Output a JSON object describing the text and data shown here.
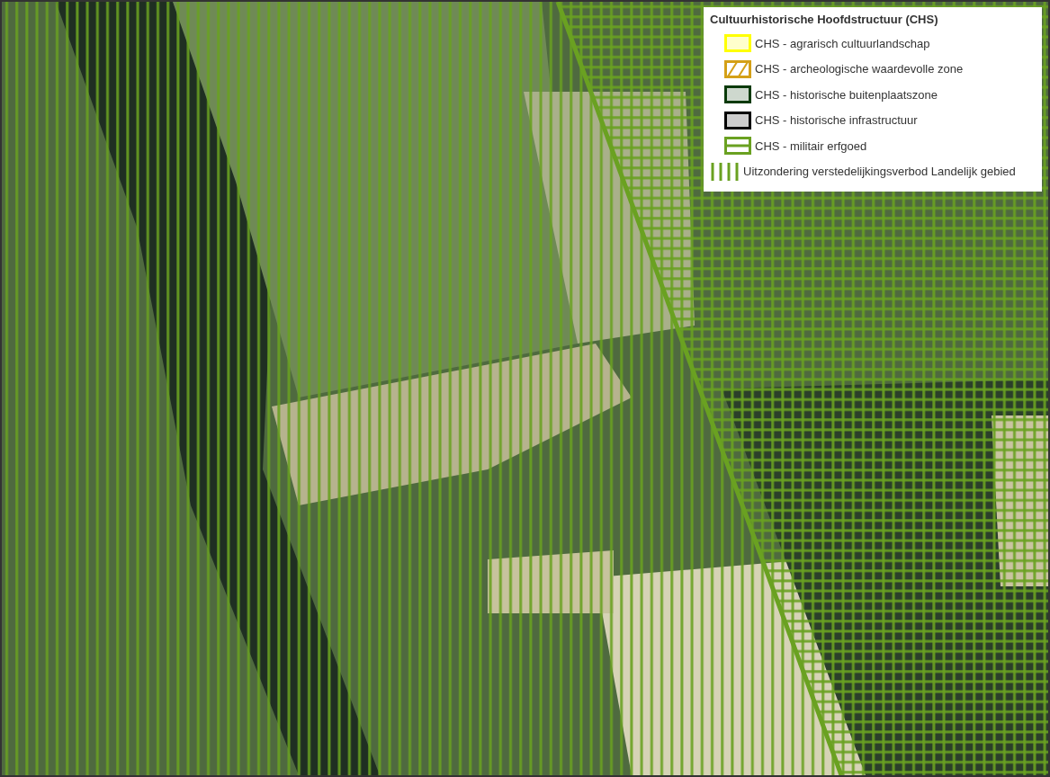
{
  "legend": {
    "title": "Cultuurhistorische Hoofdstructuur (CHS)",
    "items": [
      {
        "kind": "fill",
        "color": "#ffff00",
        "label": "CHS - agrarisch cultuurlandschap"
      },
      {
        "kind": "diagonal",
        "color": "#d4a017",
        "label": "CHS - archeologische waardevolle zone"
      },
      {
        "kind": "fill",
        "color": "#0a3a0a",
        "label": "CHS - historische buitenplaatszone"
      },
      {
        "kind": "fill",
        "color": "#000000",
        "label": "CHS - historische infrastructuur"
      },
      {
        "kind": "horizontal",
        "color": "#6aa121",
        "label": "CHS - militair erfgoed"
      },
      {
        "kind": "vertical",
        "color": "#6aa121",
        "label": "Uitzondering verstedelijkingsverbod Landelijk gebied"
      }
    ]
  }
}
